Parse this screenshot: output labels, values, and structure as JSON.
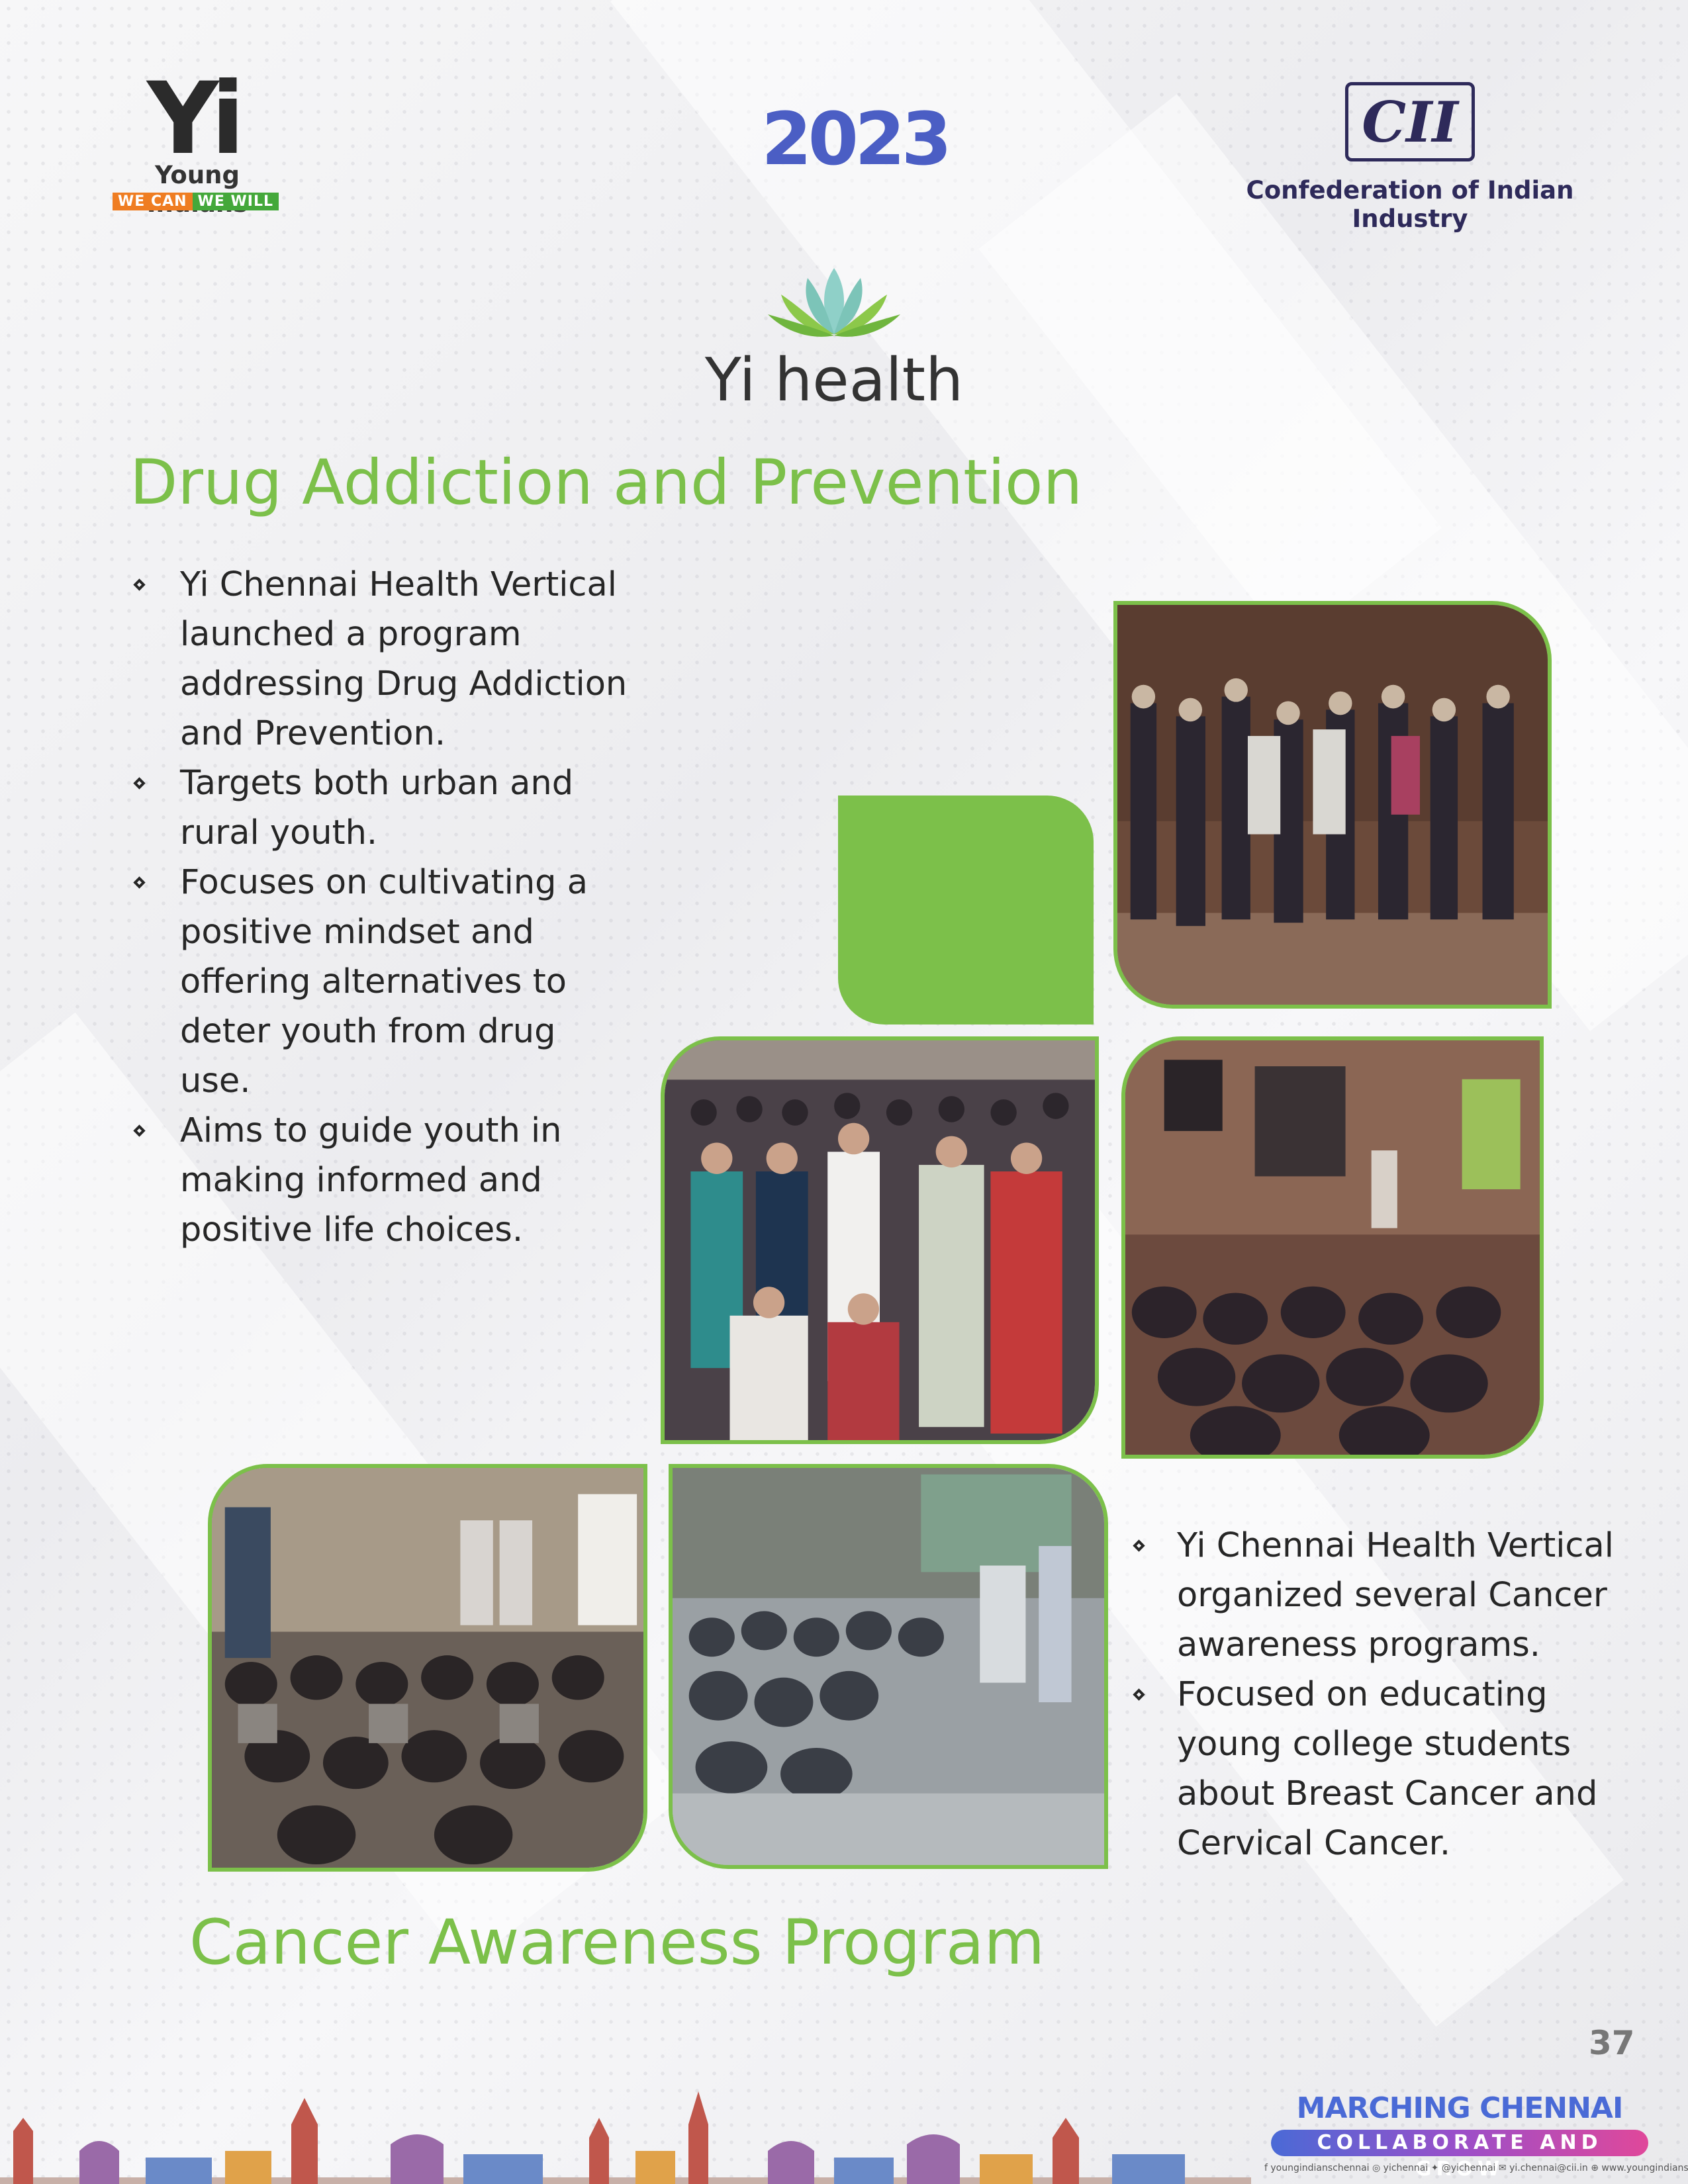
{
  "header": {
    "yi_logo": {
      "mark": "Yi",
      "name": "Young Indians",
      "tag_left": "WE CAN",
      "tag_right": "WE WILL"
    },
    "year": "2023",
    "cii_logo": {
      "mark": "CII",
      "name": "Confederation of Indian Industry"
    },
    "vertical_logo": {
      "text": "Yi health"
    }
  },
  "section_drug": {
    "title": "Drug Addiction and Prevention",
    "bullets": [
      "Yi Chennai Health Vertical launched a program addressing Drug Addiction and Prevention.",
      "Targets both urban and rural youth.",
      "Focuses on cultivating a positive mindset and offering alternatives to deter youth from drug use.",
      "Aims to guide youth in making informed and positive life choices."
    ]
  },
  "section_cancer": {
    "title": "Cancer Awareness Program",
    "bullets": [
      "Yi Chennai Health Vertical organized several Cancer awareness programs.",
      "Focused on educating young college students about Breast Cancer and Cervical Cancer."
    ]
  },
  "footer": {
    "page_number": "37",
    "campaign_title": "MARCHING CHENNAI AHEAD",
    "campaign_tagline": "COLLABORATE AND GROW",
    "social": "f youngindianschennai   ◎ yichennai   ✦ @yichennai   ✉ yi.chennai@cii.in   ⊕ www.youngindians.net"
  },
  "colors": {
    "accent_green": "#7cc04a",
    "text_dark": "#262626",
    "cii_navy": "#2e2a5a",
    "year_blue": "#4b5ec4"
  }
}
